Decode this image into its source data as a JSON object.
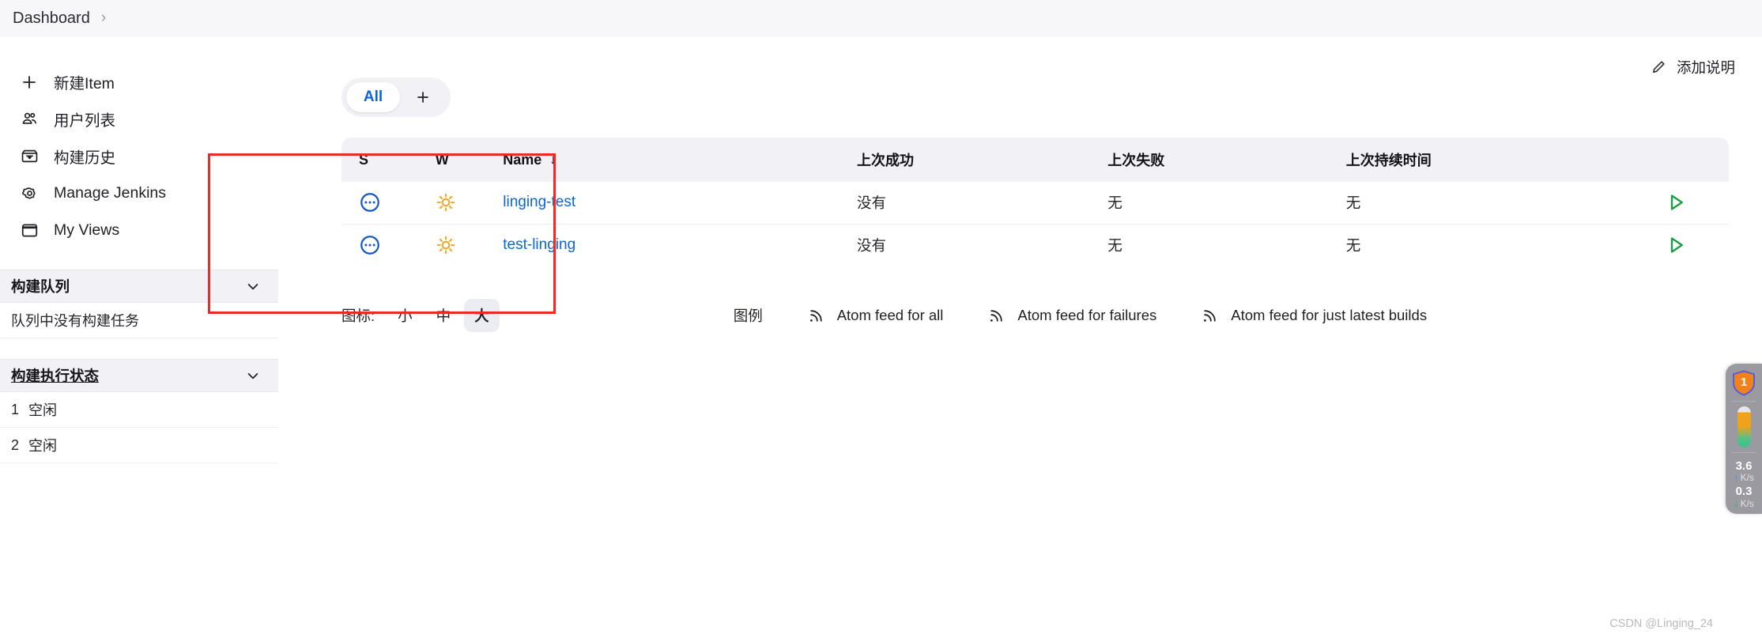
{
  "breadcrumb": {
    "root": "Dashboard",
    "separator": "›"
  },
  "sidebar": {
    "items": [
      {
        "label": "新建Item",
        "icon": "plus-icon"
      },
      {
        "label": "用户列表",
        "icon": "people-icon"
      },
      {
        "label": "构建历史",
        "icon": "inbox-icon"
      },
      {
        "label": "Manage Jenkins",
        "icon": "gear-icon"
      },
      {
        "label": "My Views",
        "icon": "window-icon"
      }
    ],
    "build_queue": {
      "title": "构建队列",
      "empty_text": "队列中没有构建任务",
      "chevron": "chevron-down-icon"
    },
    "build_executor": {
      "title": "构建执行状态",
      "chevron": "chevron-down-icon",
      "rows": [
        {
          "index": "1",
          "status": "空闲"
        },
        {
          "index": "2",
          "status": "空闲"
        }
      ]
    }
  },
  "main": {
    "add_description": {
      "label": "添加说明",
      "icon": "pencil-icon"
    },
    "tabs": [
      {
        "label": "All",
        "active": true
      }
    ],
    "tab_add_label": "+",
    "table": {
      "headers": {
        "s": "S",
        "w": "W",
        "name": "Name",
        "name_sort": "↓",
        "last_success": "上次成功",
        "last_failure": "上次失败",
        "last_duration": "上次持续时间"
      },
      "rows": [
        {
          "status_icon": "pending-dots-icon",
          "weather_icon": "sunny-icon",
          "name": "linging-test",
          "last_success": "没有",
          "last_failure": "无",
          "last_duration": "无",
          "run_icon": "play-icon"
        },
        {
          "status_icon": "pending-dots-icon",
          "weather_icon": "sunny-icon",
          "name": "test-linging",
          "last_success": "没有",
          "last_failure": "无",
          "last_duration": "无",
          "run_icon": "play-icon"
        }
      ]
    },
    "footer": {
      "icon_size_label": "图标:",
      "sizes": [
        {
          "label": "小",
          "active": false
        },
        {
          "label": "中",
          "active": false
        },
        {
          "label": "大",
          "active": true
        }
      ],
      "legend_label": "图例",
      "feeds": [
        {
          "label": "Atom feed for all",
          "icon": "rss-icon"
        },
        {
          "label": "Atom feed for failures",
          "icon": "rss-icon"
        },
        {
          "label": "Atom feed for just latest builds",
          "icon": "rss-icon"
        }
      ]
    }
  },
  "net_widget": {
    "shield_count": "1",
    "upload_value": "3.6",
    "upload_unit": "K/s",
    "download_value": "0.3",
    "download_unit": "K/s",
    "upload_arrow": "↑",
    "download_arrow": "↓"
  },
  "watermark": "CSDN @Linging_24",
  "colors": {
    "accent_blue": "#0b65d8",
    "status_blue": "#1457c8",
    "weather_orange": "#f5a623",
    "run_green": "#1a9e44",
    "annotation_red": "#f02828",
    "panel_grey": "#f2f2f6"
  }
}
